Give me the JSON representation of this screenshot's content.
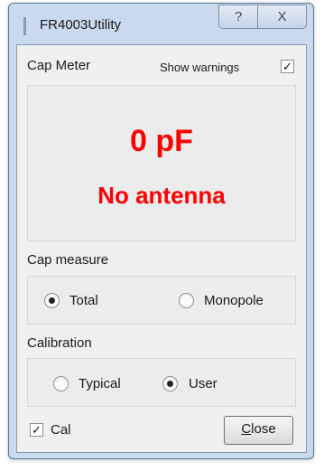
{
  "window": {
    "title": "FR4003Utility",
    "help_glyph": "?",
    "close_glyph": "X"
  },
  "cap_meter": {
    "label": "Cap Meter",
    "show_warnings_label": "Show warnings",
    "show_warnings_checked": true,
    "value": "0 pF",
    "status": "No antenna",
    "value_color": "#ff0000"
  },
  "cap_measure": {
    "label": "Cap measure",
    "options": [
      {
        "label": "Total",
        "selected": true
      },
      {
        "label": "Monopole",
        "selected": false
      }
    ]
  },
  "calibration": {
    "label": "Calibration",
    "options": [
      {
        "label": "Typical",
        "selected": false
      },
      {
        "label": "User",
        "selected": true
      }
    ]
  },
  "footer": {
    "cal_label": "Cal",
    "cal_checked": true,
    "close_first_letter": "C",
    "close_rest": "lose"
  },
  "check_glyph": "✓"
}
